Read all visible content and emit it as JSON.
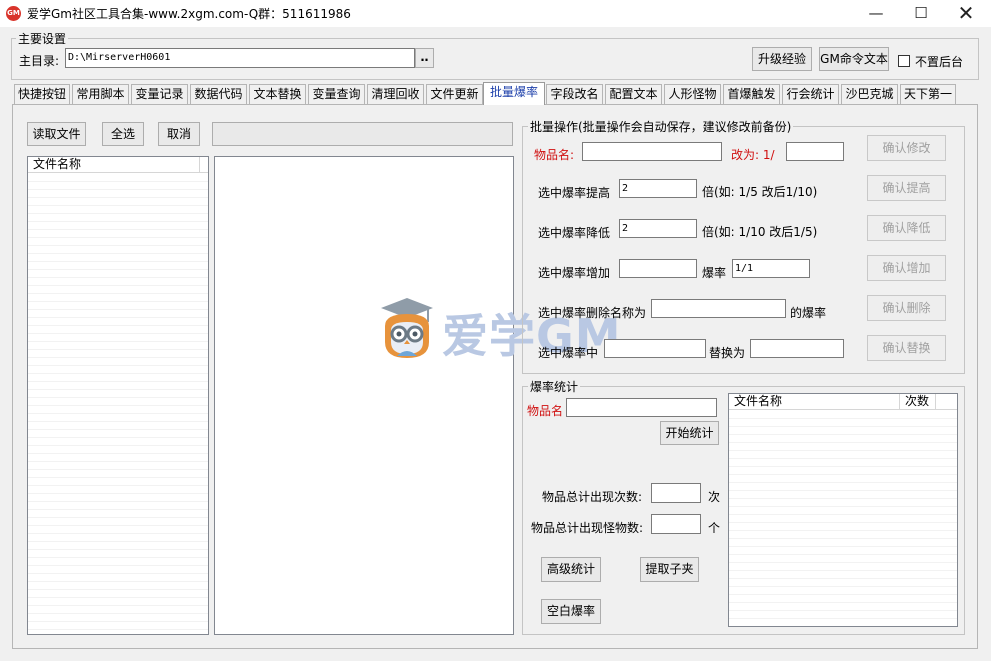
{
  "window": {
    "title": "爱学Gm社区工具合集-www.2xgm.com-Q群：511611986",
    "icon_text": "GM"
  },
  "main_settings": {
    "group_title": "主要设置",
    "dir_label": "主目录:",
    "dir_value": "D:\\MirserverH0601",
    "browse_label": "‥",
    "upgrade_exp_label": "升级经验",
    "gm_cmd_label": "GM命令文本",
    "no_background_label": "不置后台",
    "no_background_checked": false
  },
  "tabs": [
    {
      "label": "快捷按钮",
      "active": false
    },
    {
      "label": "常用脚本",
      "active": false
    },
    {
      "label": "变量记录",
      "active": false
    },
    {
      "label": "数据代码",
      "active": false
    },
    {
      "label": "文本替换",
      "active": false
    },
    {
      "label": "变量查询",
      "active": false
    },
    {
      "label": "清理回收",
      "active": false
    },
    {
      "label": "文件更新",
      "active": false
    },
    {
      "label": "批量爆率",
      "active": true
    },
    {
      "label": "字段改名",
      "active": false
    },
    {
      "label": "配置文本",
      "active": false
    },
    {
      "label": "人形怪物",
      "active": false
    },
    {
      "label": "首爆触发",
      "active": false
    },
    {
      "label": "行会统计",
      "active": false
    },
    {
      "label": "沙巴克城",
      "active": false
    },
    {
      "label": "天下第一",
      "active": false
    }
  ],
  "left": {
    "read_file_label": "读取文件",
    "select_all_label": "全选",
    "cancel_label": "取消",
    "file_list_header": "文件名称"
  },
  "batch": {
    "group_title": "批量操作(批量操作会自动保存，建议修改前备份)",
    "item_name_label": "物品名:",
    "change_to_label": "改为: 1/",
    "confirm_modify": "确认修改",
    "raise_label": "选中爆率提高",
    "raise_value": "2",
    "raise_hint": "倍(如: 1/5 改后1/10)",
    "confirm_raise": "确认提高",
    "lower_label": "选中爆率降低",
    "lower_value": "2",
    "lower_hint": "倍(如: 1/10 改后1/5)",
    "confirm_lower": "确认降低",
    "add_label": "选中爆率增加",
    "rate_label": "爆率",
    "rate_value": "1/1",
    "confirm_add": "确认增加",
    "delete_label": "选中爆率删除名称为",
    "delete_suffix": "的爆率",
    "confirm_delete": "确认删除",
    "replace_label": "选中爆率中",
    "replace_with_label": "替换为",
    "confirm_replace": "确认替换"
  },
  "stats": {
    "group_title": "爆率统计",
    "item_name_label": "物品名",
    "start_label": "开始统计",
    "total_count_label": "物品总计出现次数:",
    "total_count_unit": "次",
    "monster_count_label": "物品总计出现怪物数:",
    "monster_count_unit": "个",
    "advanced_label": "高级统计",
    "extract_label": "提取子夹",
    "blank_label": "空白爆率",
    "col_file": "文件名称",
    "col_count": "次数"
  },
  "watermark": {
    "text": "爱学GM"
  }
}
